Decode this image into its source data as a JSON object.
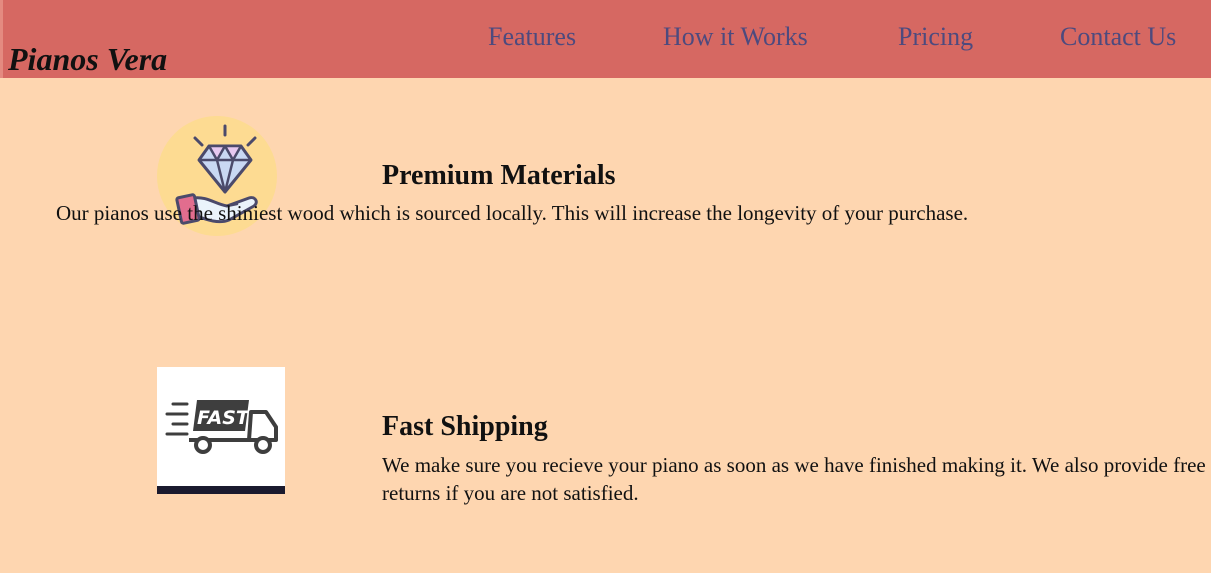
{
  "header": {
    "brand": "Pianos Vera",
    "nav": [
      "Features",
      "How it Works",
      "Pricing",
      "Contact Us"
    ]
  },
  "features": [
    {
      "icon": "diamond-hand-icon",
      "title": "Premium Materials",
      "text": "Our pianos use the shiniest wood which is sourced locally. This will increase the longevity of your purchase."
    },
    {
      "icon": "fast-truck-icon",
      "badge": "FAST",
      "title": "Fast Shipping",
      "text": "We make sure you recieve your piano as soon as we have finished making it. We also provide free returns if you are not satisfied."
    }
  ],
  "colors": {
    "header": "#D66862",
    "background": "#FED6B0",
    "nav_text": "#4D4A7E"
  }
}
